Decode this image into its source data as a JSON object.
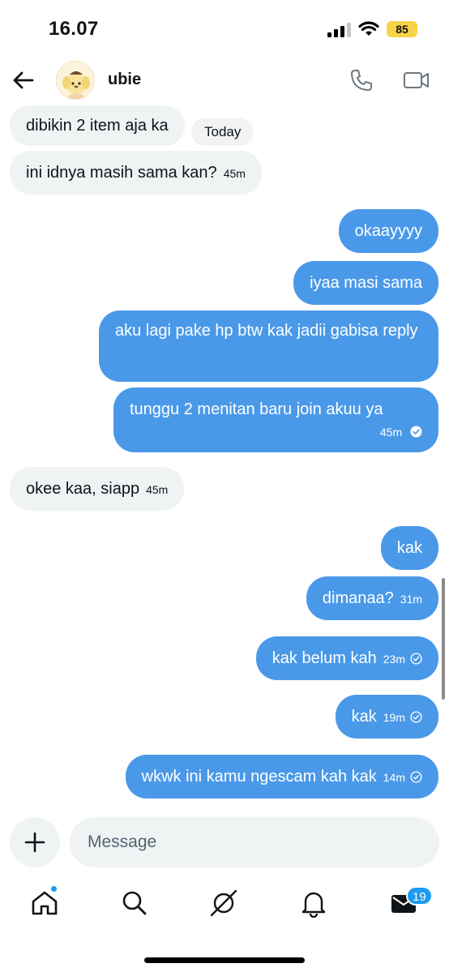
{
  "status_bar": {
    "time": "16.07",
    "battery": "85"
  },
  "header": {
    "contact_name": "ubie"
  },
  "chat": {
    "date_separator": "Today",
    "messages": [
      {
        "dir": "in",
        "text": "dibikin 2 item aja ka",
        "time": ""
      },
      {
        "dir": "in",
        "text": "ini idnya masih sama kan?",
        "time": "45m"
      },
      {
        "dir": "out",
        "text": "okaayyyy",
        "time": ""
      },
      {
        "dir": "out",
        "text": "iyaa masi sama",
        "time": ""
      },
      {
        "dir": "out",
        "text": "aku lagi pake hp btw kak jadii gabisa reply",
        "time": ""
      },
      {
        "dir": "out",
        "text": "tunggu 2 menitan baru join akuu ya",
        "time": "45m",
        "status": "read"
      },
      {
        "dir": "in",
        "text": "okee kaa, siapp",
        "time": "45m"
      },
      {
        "dir": "out",
        "text": "kak",
        "time": ""
      },
      {
        "dir": "out",
        "text": "dimanaa?",
        "time": "31m"
      },
      {
        "dir": "out",
        "text": "kak belum kah",
        "time": "23m",
        "status": "sent"
      },
      {
        "dir": "out",
        "text": "kak",
        "time": "19m",
        "status": "sent"
      },
      {
        "dir": "out",
        "text": "wkwk ini kamu ngescam kah kak",
        "time": "14m",
        "status": "sent"
      }
    ]
  },
  "composer": {
    "placeholder": "Message"
  },
  "nav": {
    "items": [
      "home-icon",
      "search-icon",
      "grok-icon",
      "notifications-icon",
      "messages-icon"
    ],
    "messages_badge": "19"
  },
  "colors": {
    "outgoing": "#4a99e9",
    "incoming": "#eff3f4",
    "accent": "#1d9bf0"
  }
}
